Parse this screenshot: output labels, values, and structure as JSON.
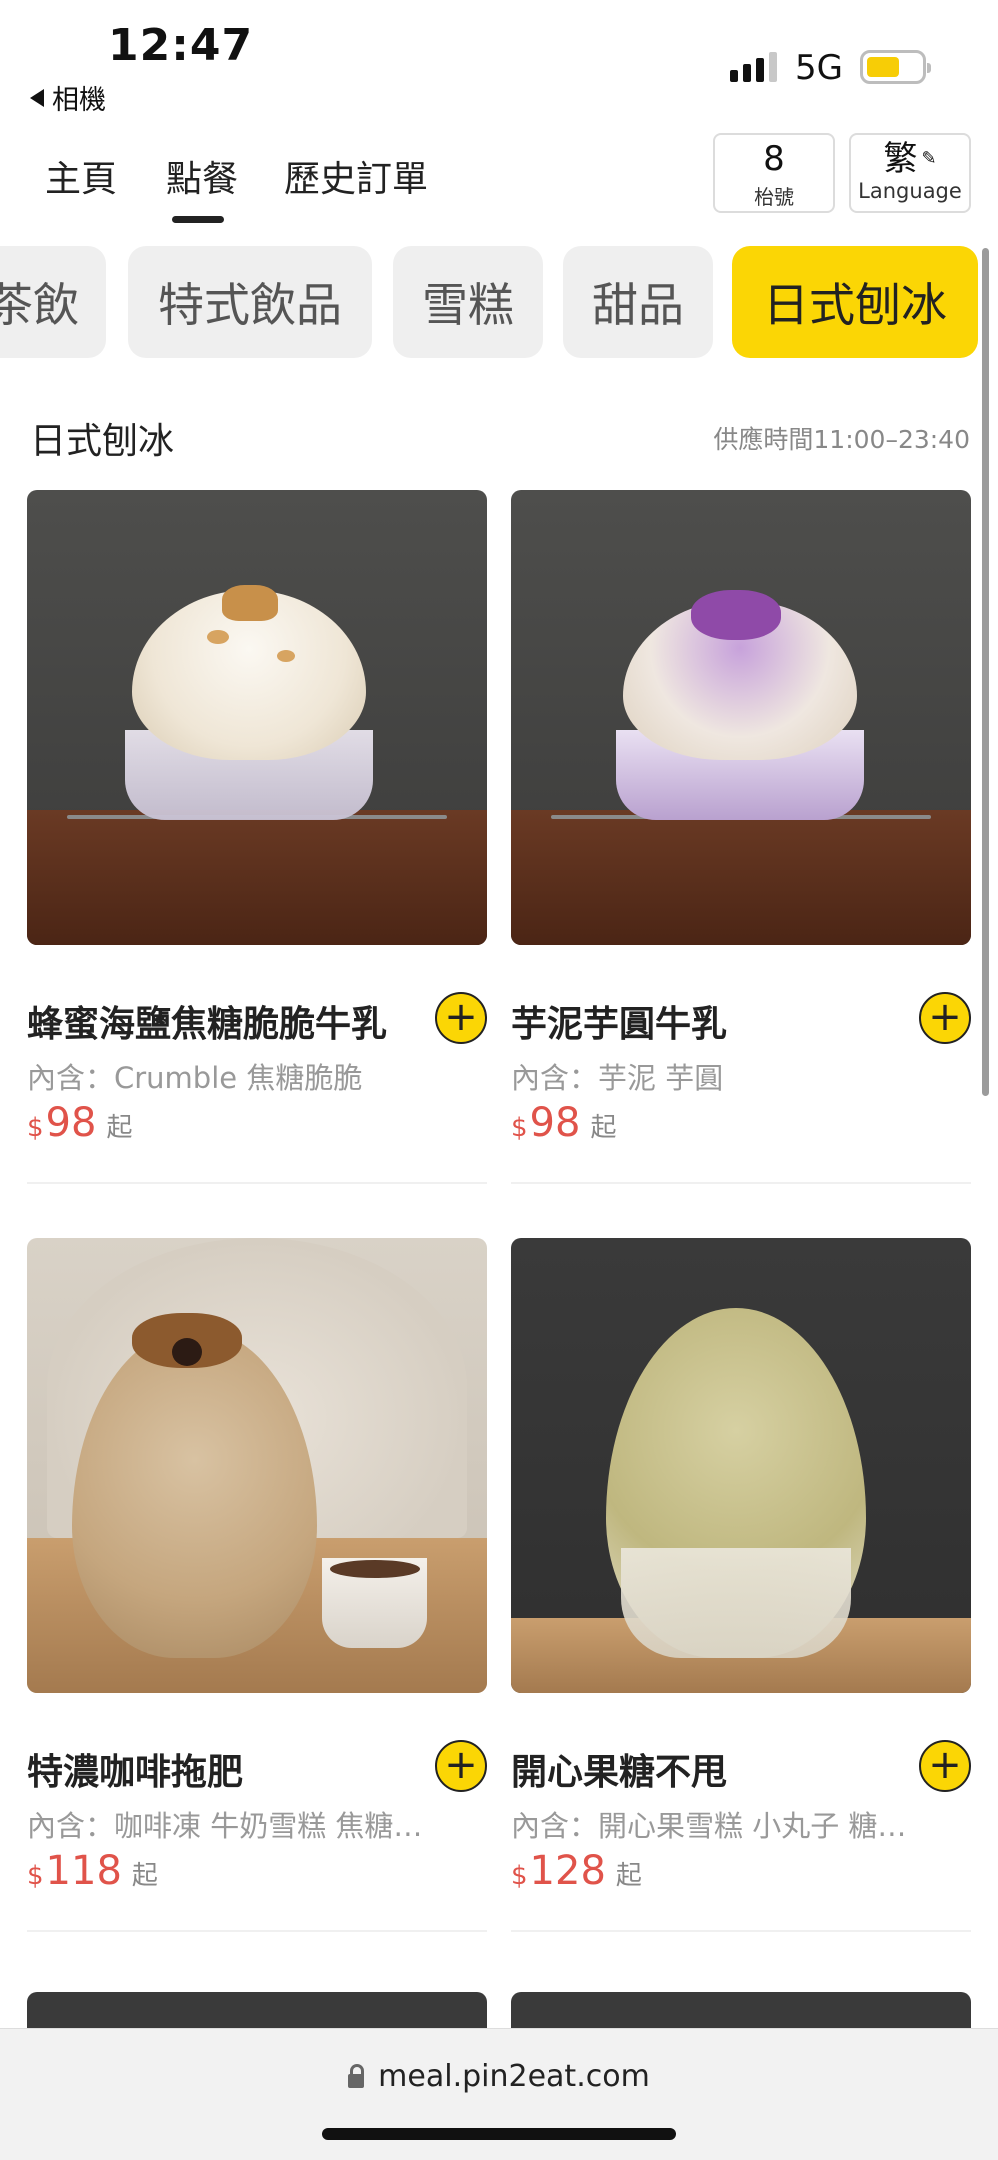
{
  "status_bar": {
    "time": "12:47",
    "back_app": "相機",
    "network": "5G",
    "battery_level": 0.55,
    "signal_bars_active": 3
  },
  "nav": {
    "tabs": [
      {
        "label": "主頁",
        "active": false
      },
      {
        "label": "點餐",
        "active": true
      },
      {
        "label": "歷史訂單",
        "active": false
      }
    ],
    "table": {
      "number": "8",
      "label": "枱號"
    },
    "language": {
      "current": "繁",
      "label": "Language"
    }
  },
  "categories": [
    {
      "label": "茶飲",
      "active": false
    },
    {
      "label": "特式飲品",
      "active": false
    },
    {
      "label": "雪糕",
      "active": false
    },
    {
      "label": "甜品",
      "active": false
    },
    {
      "label": "日式刨冰",
      "active": true
    }
  ],
  "section": {
    "title": "日式刨冰",
    "hours": "供應時間11:00–23:40"
  },
  "products": [
    {
      "name": "蜂蜜海鹽焦糖脆脆牛乳",
      "desc": "內含：Crumble 焦糖脆脆",
      "currency": "$",
      "price": "98",
      "from": "起"
    },
    {
      "name": "芋泥芋圓牛乳",
      "desc": "內含：芋泥 芋圓",
      "currency": "$",
      "price": "98",
      "from": "起"
    },
    {
      "name": "特濃咖啡拖肥",
      "desc": "內含：咖啡凍 牛奶雪糕 焦糖…",
      "currency": "$",
      "price": "118",
      "from": "起"
    },
    {
      "name": "開心果糖不甩",
      "desc": "內含：開心果雪糕 小丸子 糖…",
      "currency": "$",
      "price": "128",
      "from": "起"
    }
  ],
  "browser": {
    "url": "meal.pin2eat.com"
  },
  "colors": {
    "accent": "#fbd605",
    "price": "#e0534a",
    "muted": "#999999"
  }
}
